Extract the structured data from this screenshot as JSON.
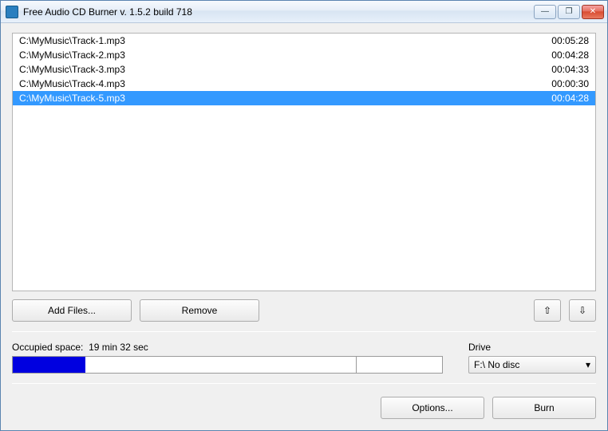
{
  "window": {
    "title": "Free Audio CD Burner  v. 1.5.2 build 718"
  },
  "tracks": [
    {
      "path": "C:\\MyMusic\\Track-1.mp3",
      "duration": "00:05:28",
      "selected": false
    },
    {
      "path": "C:\\MyMusic\\Track-2.mp3",
      "duration": "00:04:28",
      "selected": false
    },
    {
      "path": "C:\\MyMusic\\Track-3.mp3",
      "duration": "00:04:33",
      "selected": false
    },
    {
      "path": "C:\\MyMusic\\Track-4.mp3",
      "duration": "00:00:30",
      "selected": false
    },
    {
      "path": "C:\\MyMusic\\Track-5.mp3",
      "duration": "00:04:28",
      "selected": true
    }
  ],
  "buttons": {
    "add_files": "Add Files...",
    "remove": "Remove",
    "options": "Options...",
    "burn": "Burn",
    "move_up_glyph": "⇧",
    "move_down_glyph": "⇩"
  },
  "status": {
    "occupied_label": "Occupied space:",
    "occupied_value": "19 min 32 sec",
    "progress_percent": 17,
    "tick_percent": 80
  },
  "drive": {
    "label": "Drive",
    "selected": "F:\\ No disc",
    "dropdown_glyph": "▾"
  },
  "winbtn": {
    "min": "—",
    "max": "❐",
    "close": "✕"
  }
}
